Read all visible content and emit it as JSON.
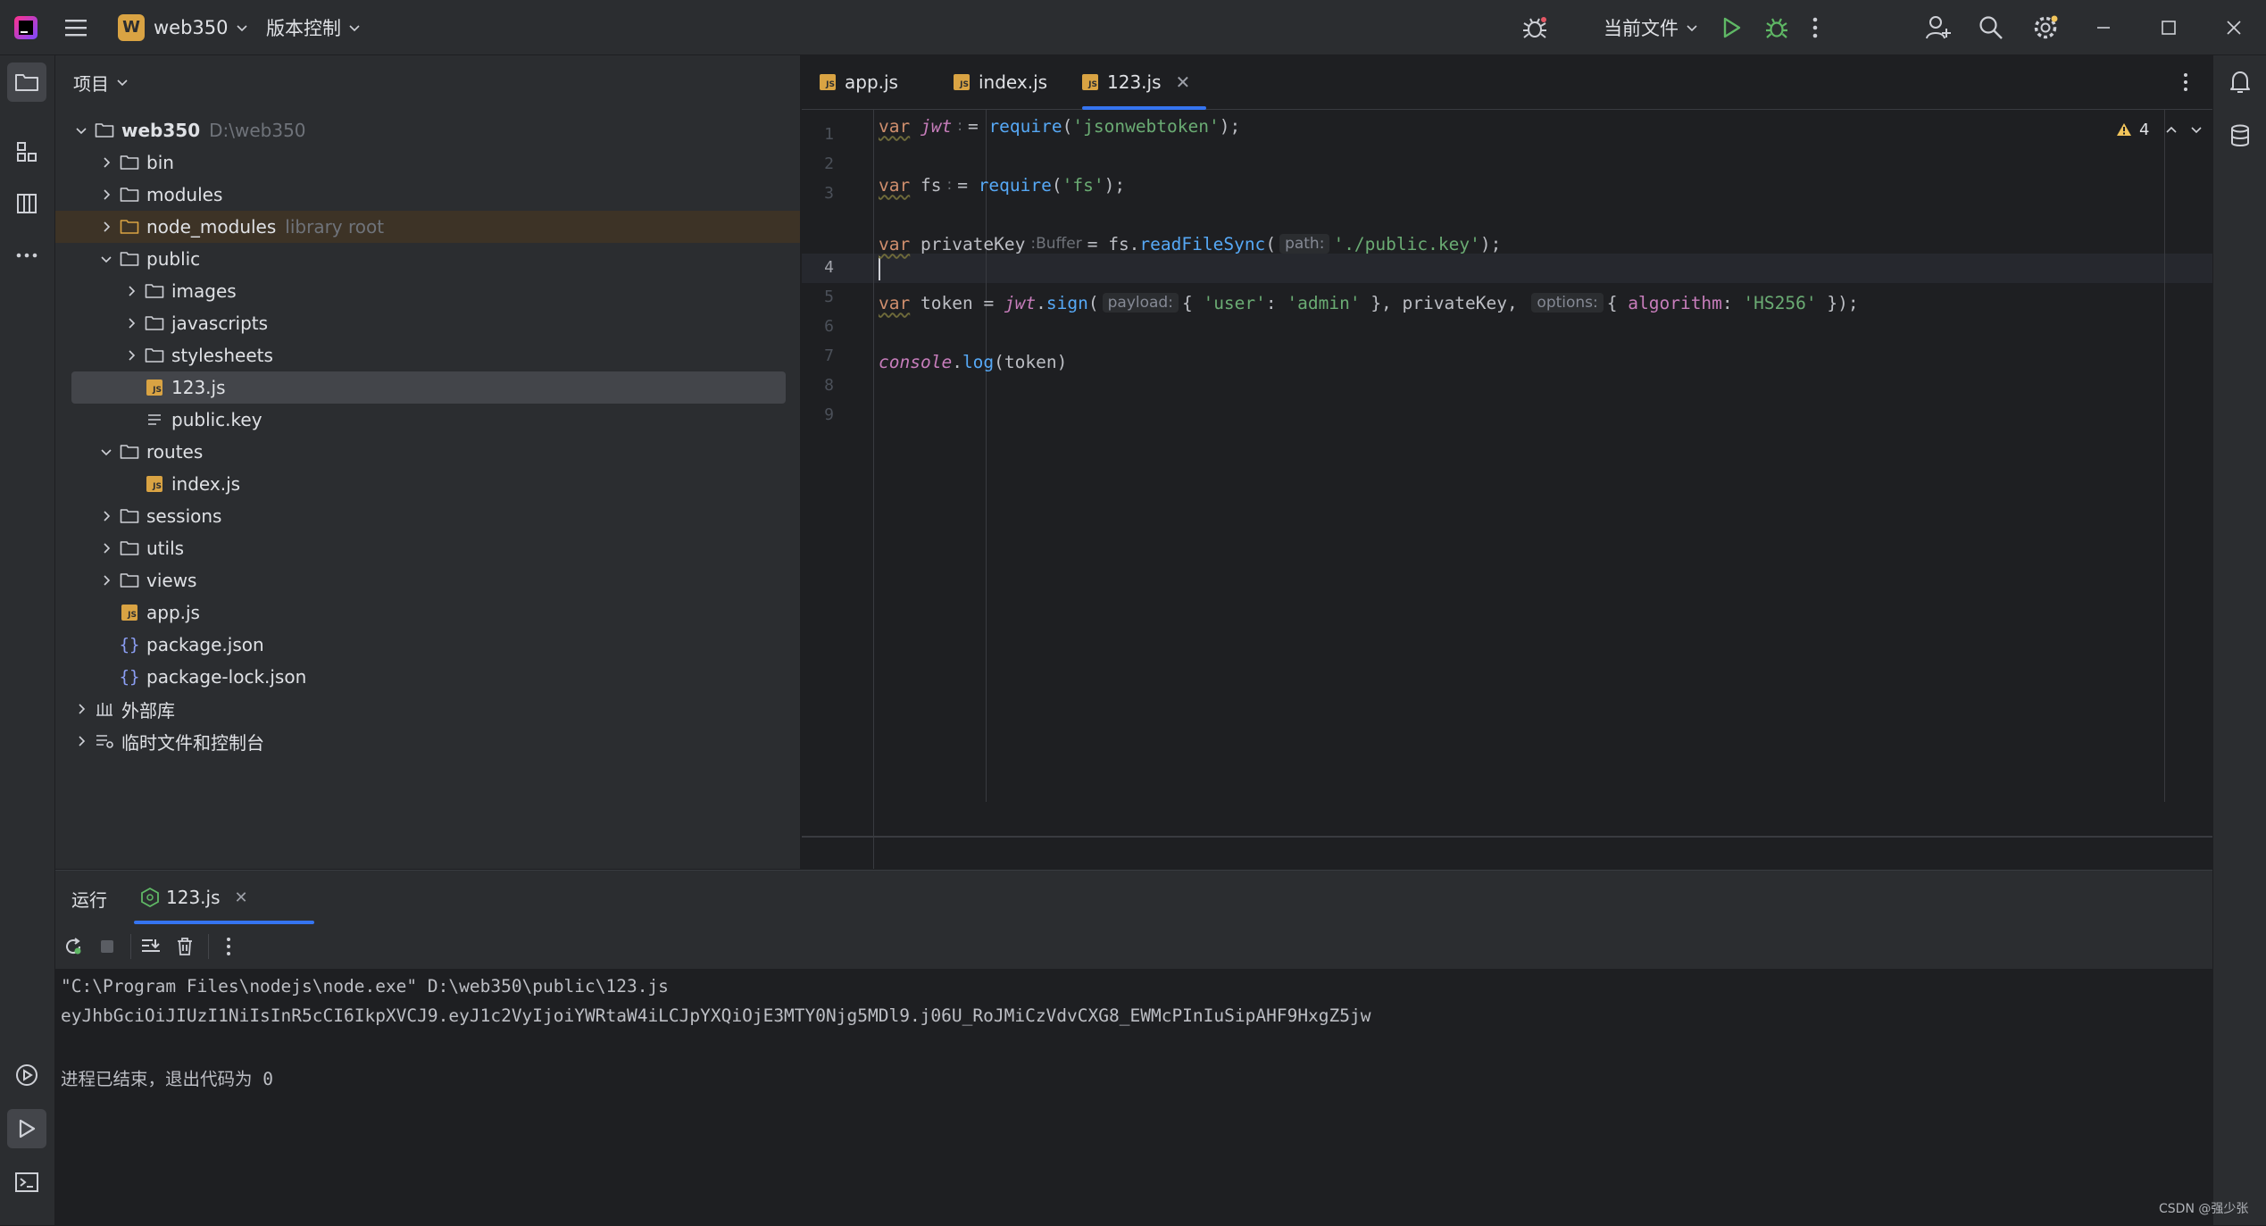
{
  "titlebar": {
    "project_badge": "W",
    "project_name": "web350",
    "vcs_label": "版本控制",
    "run_config": "当前文件"
  },
  "project_panel": {
    "title": "项目",
    "tree": [
      {
        "label": "web350",
        "hint": "D:\\web350",
        "depth": 0,
        "type": "folder",
        "expanded": true,
        "bold": true
      },
      {
        "label": "bin",
        "depth": 1,
        "type": "folder",
        "expanded": false
      },
      {
        "label": "modules",
        "depth": 1,
        "type": "folder",
        "expanded": false
      },
      {
        "label": "node_modules",
        "hint": "library root",
        "depth": 1,
        "type": "folder-lib",
        "expanded": false
      },
      {
        "label": "public",
        "depth": 1,
        "type": "folder",
        "expanded": true
      },
      {
        "label": "images",
        "depth": 2,
        "type": "folder",
        "expanded": false
      },
      {
        "label": "javascripts",
        "depth": 2,
        "type": "folder",
        "expanded": false
      },
      {
        "label": "stylesheets",
        "depth": 2,
        "type": "folder",
        "expanded": false
      },
      {
        "label": "123.js",
        "depth": 2,
        "type": "js",
        "selected": true
      },
      {
        "label": "public.key",
        "depth": 2,
        "type": "text"
      },
      {
        "label": "routes",
        "depth": 1,
        "type": "folder",
        "expanded": true
      },
      {
        "label": "index.js",
        "depth": 2,
        "type": "js"
      },
      {
        "label": "sessions",
        "depth": 1,
        "type": "folder",
        "expanded": false
      },
      {
        "label": "utils",
        "depth": 1,
        "type": "folder",
        "expanded": false
      },
      {
        "label": "views",
        "depth": 1,
        "type": "folder",
        "expanded": false
      },
      {
        "label": "app.js",
        "depth": 1,
        "type": "js"
      },
      {
        "label": "package.json",
        "depth": 1,
        "type": "json"
      },
      {
        "label": "package-lock.json",
        "depth": 1,
        "type": "json"
      },
      {
        "label": "外部库",
        "depth": 0,
        "type": "library",
        "expanded": false
      },
      {
        "label": "临时文件和控制台",
        "depth": 0,
        "type": "scratch",
        "expanded": false
      }
    ]
  },
  "editor": {
    "tabs": [
      {
        "label": "app.js",
        "active": false
      },
      {
        "label": "index.js",
        "active": false
      },
      {
        "label": "123.js",
        "active": true
      }
    ],
    "warning_count": "4",
    "current_line": 4,
    "line_numbers": [
      "1",
      "2",
      "3",
      "4",
      "5",
      "6",
      "7",
      "8",
      "9"
    ],
    "code": {
      "l1_kw": "var",
      "l1_name": "jwt",
      "l1_hint": ":",
      "l1_rest_a": "= ",
      "l1_fn": "require",
      "l1_rest_b": "(",
      "l1_str": "'jsonwebtoken'",
      "l1_rest_c": ");",
      "l3_kw": "var",
      "l3_name": "fs",
      "l3_hint": ":",
      "l3_rest_a": "= ",
      "l3_fn": "require",
      "l3_rest_b": "(",
      "l3_str": "'fs'",
      "l3_rest_c": ");",
      "l5_kw": "var",
      "l5_name": "privateKey",
      "l5_hint": ":Buffer",
      "l5_rest_a": "= fs.",
      "l5_fn": "readFileSync",
      "l5_rest_b": "(",
      "l5_inlay": "path:",
      "l5_str": "'./public.key'",
      "l5_rest_c": ");",
      "l7_kw": "var",
      "l7_name": "token",
      "l7_rest_a": "= ",
      "l7_obj": "jwt",
      "l7_rest_b": ".",
      "l7_fn": "sign",
      "l7_rest_c": "(",
      "l7_inlay1": "payload:",
      "l7_rest_d": "{ ",
      "l7_str1": "'user'",
      "l7_rest_e": ": ",
      "l7_str2": "'admin'",
      "l7_rest_f": " }, privateKey, ",
      "l7_inlay2": "options:",
      "l7_rest_g": "{ ",
      "l7_prop": "algorithm",
      "l7_rest_h": ": ",
      "l7_str3": "'HS256'",
      "l7_rest_i": " });",
      "l9_obj": "console",
      "l9_rest_a": ".",
      "l9_fn": "log",
      "l9_rest_b": "(token)"
    }
  },
  "run_panel": {
    "title": "运行",
    "tab_label": "123.js",
    "output": [
      "\"C:\\Program Files\\nodejs\\node.exe\" D:\\web350\\public\\123.js",
      "eyJhbGciOiJIUzI1NiIsInR5cCI6IkpXVCJ9.eyJ1c2VyIjoiYWRtaW4iLCJpYXQiOjE3MTY0Njg5MDl9.j06U_RoJMiCzVdvCXG8_EWMcPInIuSipAHF9HxgZ5jw",
      "",
      "进程已结束，退出代码为 0"
    ]
  },
  "watermark": "CSDN @强少张",
  "colors": {
    "accent": "#3574f0",
    "js_badge": "#d9a343",
    "run_green": "#5fb865",
    "warning": "#f2c55c"
  }
}
